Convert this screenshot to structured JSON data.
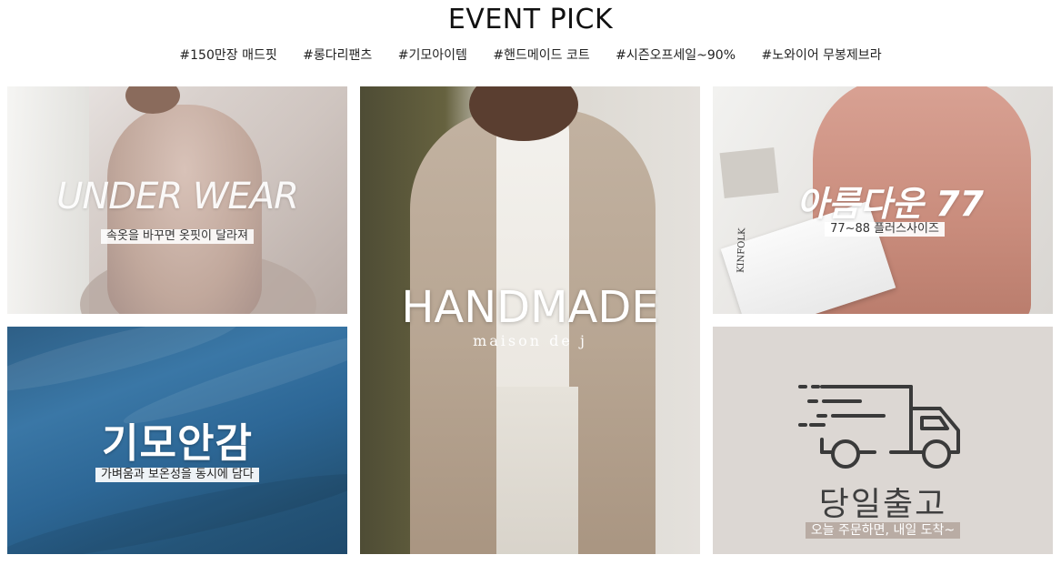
{
  "header": {
    "title": "EVENT PICK",
    "tags": [
      "#150만장 매드핏",
      "#롱다리팬츠",
      "#기모아이템",
      "#핸드메이드 코트",
      "#시즌오프세일~90%",
      "#노와이어 무봉제브라"
    ]
  },
  "cards": {
    "underwear": {
      "headline": "UNDER WEAR",
      "subtitle": "속옷을 바꾸면 옷핏이 달라져"
    },
    "fleece": {
      "headline": "기모안감",
      "subtitle": "가벼움과 보온성을 동시에 담다"
    },
    "handmade": {
      "headline": "HANDMADE",
      "subtitle": "maison de j"
    },
    "plussize": {
      "headline": "아름다운 77",
      "subtitle": "77~88 플러스사이즈",
      "magazine_text": "KINFOLK"
    },
    "delivery": {
      "headline": "당일출고",
      "subtitle": "오늘 주문하면, 내일 도착~",
      "icon": "delivery-truck-icon"
    }
  },
  "colors": {
    "fleece_blue": "#2d6796",
    "delivery_bg": "#dcd7d3",
    "delivery_badge": "#b9aca4",
    "icon_stroke": "#3a3a3a"
  }
}
